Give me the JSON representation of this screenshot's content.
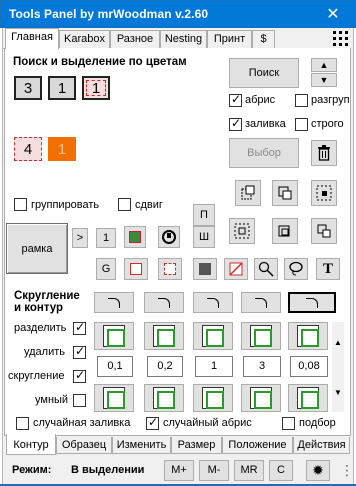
{
  "window": {
    "title": "Tools Panel by mrWoodman v.2.60",
    "close_glyph": "✕"
  },
  "top_tabs": [
    {
      "label": "Главная",
      "active": true
    },
    {
      "label": "Karabox"
    },
    {
      "label": "Разное"
    },
    {
      "label": "Nesting"
    },
    {
      "label": "Принт"
    },
    {
      "label": "$"
    }
  ],
  "grid_icon": "grid-dots-icon",
  "color_search": {
    "heading": "Поиск и выделение по цветам",
    "swatches_row1": [
      "3",
      "1",
      "1"
    ],
    "swatches_row2": [
      "4",
      "1"
    ],
    "search_button": "Поиск",
    "abris_label": "абрис",
    "abris_checked": true,
    "razgroup_label": "разгруп",
    "razgroup_checked": false,
    "fill_label": "заливка",
    "fill_checked": true,
    "strict_label": "строго",
    "strict_checked": false,
    "select_button": "Выбор",
    "orange_color": "#f27000",
    "red_dashed_color": "#d22b2b"
  },
  "group_options": {
    "group_label": "группировать",
    "shift_label": "сдвиг"
  },
  "frame": {
    "frame_button": "рамка",
    "gt_button": ">",
    "one_button": "1",
    "p_button": "П",
    "sh_button": "Ш",
    "g_button": "G",
    "text_button": "T"
  },
  "rounding": {
    "heading_line1": "Скругление",
    "heading_line2": "и контур",
    "split_label": "разделить",
    "split_checked": true,
    "delete_label": "удалить",
    "delete_checked": true,
    "round_label": "скругление",
    "round_checked": true,
    "smart_label": "умный",
    "smart_checked": false,
    "values": [
      "0,1",
      "0,2",
      "1",
      "3",
      "0,08"
    ],
    "random_fill_label": "случайная заливка",
    "random_fill_checked": false,
    "random_abris_label": "случайный абрис",
    "random_abris_checked": true,
    "selection_label": "подбор",
    "selection_checked": false
  },
  "bottom_tabs": [
    {
      "label": "Контур",
      "active": true
    },
    {
      "label": "Образец"
    },
    {
      "label": "Изменить"
    },
    {
      "label": "Размер"
    },
    {
      "label": "Положение"
    },
    {
      "label": "Действия"
    }
  ],
  "status": {
    "mode_label": "Режим:",
    "mode_value": "В выделении",
    "buttons": [
      "M+",
      "M-",
      "MR",
      "C"
    ],
    "settings_icon": "gear-icon",
    "resize_grip": "⋮"
  }
}
